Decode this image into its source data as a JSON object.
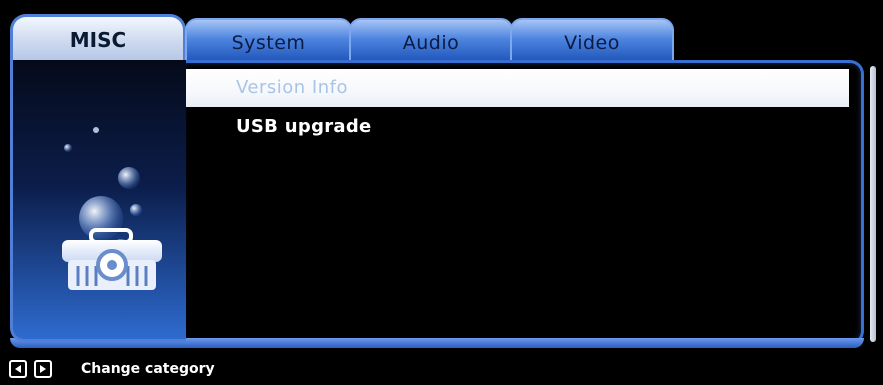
{
  "tabs": {
    "active": "MISC",
    "items": [
      {
        "label": "System"
      },
      {
        "label": "Audio"
      },
      {
        "label": "Video"
      }
    ]
  },
  "menu": {
    "items": [
      {
        "label": "Version Info",
        "selected": true
      },
      {
        "label": "USB upgrade",
        "selected": false
      }
    ]
  },
  "left_panel": {
    "icon": "toolbox-icon"
  },
  "footer": {
    "left_key_icon": "left-arrow-key-icon",
    "right_key_icon": "right-arrow-key-icon",
    "hint": "Change category"
  },
  "colors": {
    "frame_blue": "#4f7fd6",
    "tab_blue": "#4d84df",
    "selected_row": "#ffffff",
    "selected_text": "#a8c4e6",
    "background": "#000000"
  }
}
